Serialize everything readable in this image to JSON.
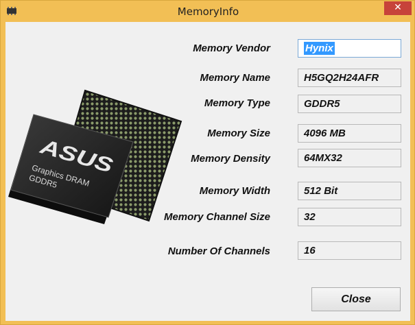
{
  "window": {
    "title": "MemoryInfo",
    "close_glyph": "✕"
  },
  "image": {
    "brand": "ASUS",
    "line1": "Graphics DRAM",
    "line2": "GDDR5"
  },
  "fields": [
    {
      "label": "Memory Vendor",
      "value": "Hynix"
    },
    {
      "label": "Memory Name",
      "value": "H5GQ2H24AFR"
    },
    {
      "label": "Memory Type",
      "value": "GDDR5"
    },
    {
      "label": "Memory Size",
      "value": "4096 MB"
    },
    {
      "label": "Memory Density",
      "value": "64MX32"
    },
    {
      "label": "Memory Width",
      "value": "512 Bit"
    },
    {
      "label": "Memory Channel Size",
      "value": "32"
    },
    {
      "label": "Number Of Channels",
      "value": "16"
    }
  ],
  "buttons": {
    "close": "Close"
  },
  "colors": {
    "titlebar": "#f2bf55",
    "close_red": "#c7433a",
    "selection": "#3399ff"
  }
}
